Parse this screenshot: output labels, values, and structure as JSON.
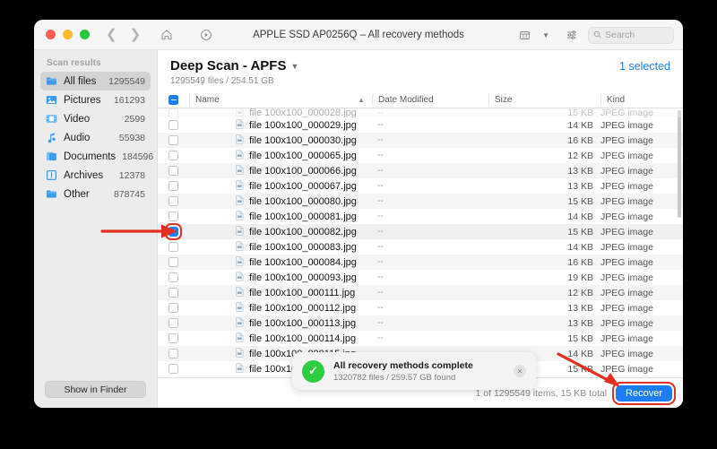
{
  "window": {
    "title": "APPLE SSD AP0256Q – All recovery methods",
    "traffic_lights": [
      "close",
      "minimize",
      "maximize"
    ]
  },
  "toolbar": {
    "back_icon": "chevron-left-icon",
    "forward_icon": "chevron-right-icon",
    "home_icon": "home-icon",
    "scan_icon": "play-circle-icon",
    "view_icon": "list-view-icon",
    "filter_icon": "filter-sliders-icon",
    "search_placeholder": "Search",
    "search_value": ""
  },
  "sidebar": {
    "title": "Scan results",
    "items": [
      {
        "label": "All files",
        "count": "1295549",
        "icon": "folder-icon",
        "active": true
      },
      {
        "label": "Pictures",
        "count": "161293",
        "icon": "picture-icon",
        "active": false
      },
      {
        "label": "Video",
        "count": "2599",
        "icon": "film-icon",
        "active": false
      },
      {
        "label": "Audio",
        "count": "55938",
        "icon": "music-note-icon",
        "active": false
      },
      {
        "label": "Documents",
        "count": "184596",
        "icon": "documents-icon",
        "active": false
      },
      {
        "label": "Archives",
        "count": "12378",
        "icon": "archive-icon",
        "active": false
      },
      {
        "label": "Other",
        "count": "878745",
        "icon": "folder-icon",
        "active": false
      }
    ],
    "show_in_finder_label": "Show in Finder"
  },
  "main": {
    "scan_title": "Deep Scan - APFS",
    "scan_subtitle": "1295549 files / 254.51 GB",
    "selected_label": "1 selected",
    "columns": [
      "Name",
      "Date Modified",
      "Size",
      "Kind"
    ],
    "header_checkbox_state": "indeterminate",
    "sort_column": "Name",
    "sort_direction": "ascending",
    "rows": [
      {
        "name": "file 100x100_000028.jpg",
        "date": "--",
        "size": "15 KB",
        "kind": "JPEG image",
        "checked": false,
        "partial": true
      },
      {
        "name": "file 100x100_000029.jpg",
        "date": "--",
        "size": "14 KB",
        "kind": "JPEG image",
        "checked": false
      },
      {
        "name": "file 100x100_000030.jpg",
        "date": "--",
        "size": "16 KB",
        "kind": "JPEG image",
        "checked": false
      },
      {
        "name": "file 100x100_000065.jpg",
        "date": "--",
        "size": "12 KB",
        "kind": "JPEG image",
        "checked": false
      },
      {
        "name": "file 100x100_000066.jpg",
        "date": "--",
        "size": "13 KB",
        "kind": "JPEG image",
        "checked": false
      },
      {
        "name": "file 100x100_000067.jpg",
        "date": "--",
        "size": "13 KB",
        "kind": "JPEG image",
        "checked": false
      },
      {
        "name": "file 100x100_000080.jpg",
        "date": "--",
        "size": "15 KB",
        "kind": "JPEG image",
        "checked": false
      },
      {
        "name": "file 100x100_000081.jpg",
        "date": "--",
        "size": "14 KB",
        "kind": "JPEG image",
        "checked": false
      },
      {
        "name": "file 100x100_000082.jpg",
        "date": "--",
        "size": "15 KB",
        "kind": "JPEG image",
        "checked": true
      },
      {
        "name": "file 100x100_000083.jpg",
        "date": "--",
        "size": "14 KB",
        "kind": "JPEG image",
        "checked": false
      },
      {
        "name": "file 100x100_000084.jpg",
        "date": "--",
        "size": "16 KB",
        "kind": "JPEG image",
        "checked": false
      },
      {
        "name": "file 100x100_000093.jpg",
        "date": "--",
        "size": "19 KB",
        "kind": "JPEG image",
        "checked": false
      },
      {
        "name": "file 100x100_000111.jpg",
        "date": "--",
        "size": "12 KB",
        "kind": "JPEG image",
        "checked": false
      },
      {
        "name": "file 100x100_000112.jpg",
        "date": "--",
        "size": "13 KB",
        "kind": "JPEG image",
        "checked": false
      },
      {
        "name": "file 100x100_000113.jpg",
        "date": "--",
        "size": "13 KB",
        "kind": "JPEG image",
        "checked": false
      },
      {
        "name": "file 100x100_000114.jpg",
        "date": "--",
        "size": "15 KB",
        "kind": "JPEG image",
        "checked": false
      },
      {
        "name": "file 100x100_000115.jpg",
        "date": "--",
        "size": "14 KB",
        "kind": "JPEG image",
        "checked": false
      },
      {
        "name": "file 100x100_000128.jpg",
        "date": "--",
        "size": "15 KB",
        "kind": "JPEG image",
        "checked": false
      }
    ]
  },
  "toast": {
    "icon": "check-circle-icon",
    "title": "All recovery methods complete",
    "subtitle": "1320782 files / 259.57 GB found",
    "close_label": "✕"
  },
  "footer": {
    "status": "1 of 1295549 items, 15 KB total",
    "recover_label": "Recover"
  },
  "annotations": {
    "arrow_color": "#e03020",
    "arrows": [
      "arrow-to-row-checkbox",
      "arrow-to-recover-button"
    ]
  },
  "colors": {
    "accent": "#1d7ef3",
    "success": "#2ecc40",
    "highlight": "#e03020",
    "sidebar_bg": "#ececec",
    "desktop_bg": "#000000"
  }
}
